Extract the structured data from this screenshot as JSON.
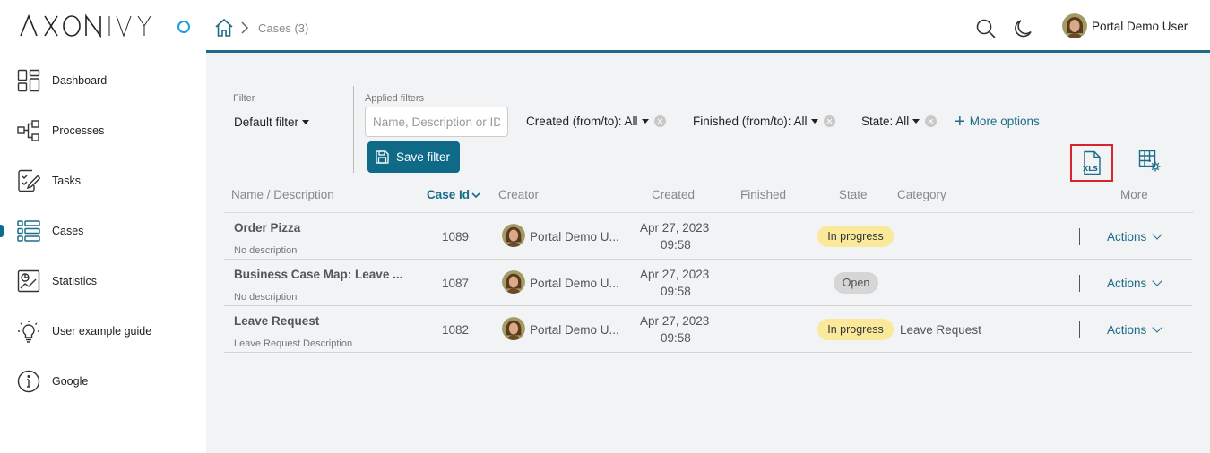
{
  "app": {
    "logo_text": "AXONIVY"
  },
  "sidebar": {
    "items": [
      {
        "label": "Dashboard",
        "icon": "dashboard-icon"
      },
      {
        "label": "Processes",
        "icon": "processes-icon"
      },
      {
        "label": "Tasks",
        "icon": "tasks-icon"
      },
      {
        "label": "Cases",
        "icon": "cases-icon",
        "active": true
      },
      {
        "label": "Statistics",
        "icon": "statistics-icon"
      },
      {
        "label": "User example guide",
        "icon": "lightbulb-icon"
      },
      {
        "label": "Google",
        "icon": "info-icon"
      }
    ]
  },
  "header": {
    "breadcrumb": "Cases (3)",
    "user_name": "Portal Demo User"
  },
  "filters": {
    "filter_label": "Filter",
    "default_filter": "Default filter",
    "applied_label": "Applied filters",
    "search_placeholder": "Name, Description or ID",
    "created": "Created (from/to): All",
    "finished": "Finished (from/to): All",
    "state": "State: All",
    "more_options": "More options",
    "save_filter": "Save filter"
  },
  "table": {
    "columns": {
      "name": "Name / Description",
      "case_id": "Case Id",
      "creator": "Creator",
      "created": "Created",
      "finished": "Finished",
      "state": "State",
      "category": "Category",
      "more": "More"
    },
    "rows": [
      {
        "name": "Order Pizza",
        "description": "No description",
        "id": "1089",
        "creator": "Portal Demo U...",
        "created_date": "Apr 27, 2023",
        "created_time": "09:58",
        "state": "In progress",
        "category": "",
        "actions": "Actions"
      },
      {
        "name": "Business Case Map: Leave ...",
        "description": "No description",
        "id": "1087",
        "creator": "Portal Demo U...",
        "created_date": "Apr 27, 2023",
        "created_time": "09:58",
        "state": "Open",
        "category": "",
        "actions": "Actions"
      },
      {
        "name": "Leave Request",
        "description": "Leave Request Description",
        "id": "1082",
        "creator": "Portal Demo U...",
        "created_date": "Apr 27, 2023",
        "created_time": "09:58",
        "state": "In progress",
        "category": "Leave Request",
        "actions": "Actions"
      }
    ]
  },
  "colors": {
    "brand": "#1b6c88",
    "logo_accent": "#1ba0d5",
    "in_progress_badge": "#fbe99b",
    "open_badge": "#d6d6d6",
    "export_highlight": "#d9232e"
  }
}
